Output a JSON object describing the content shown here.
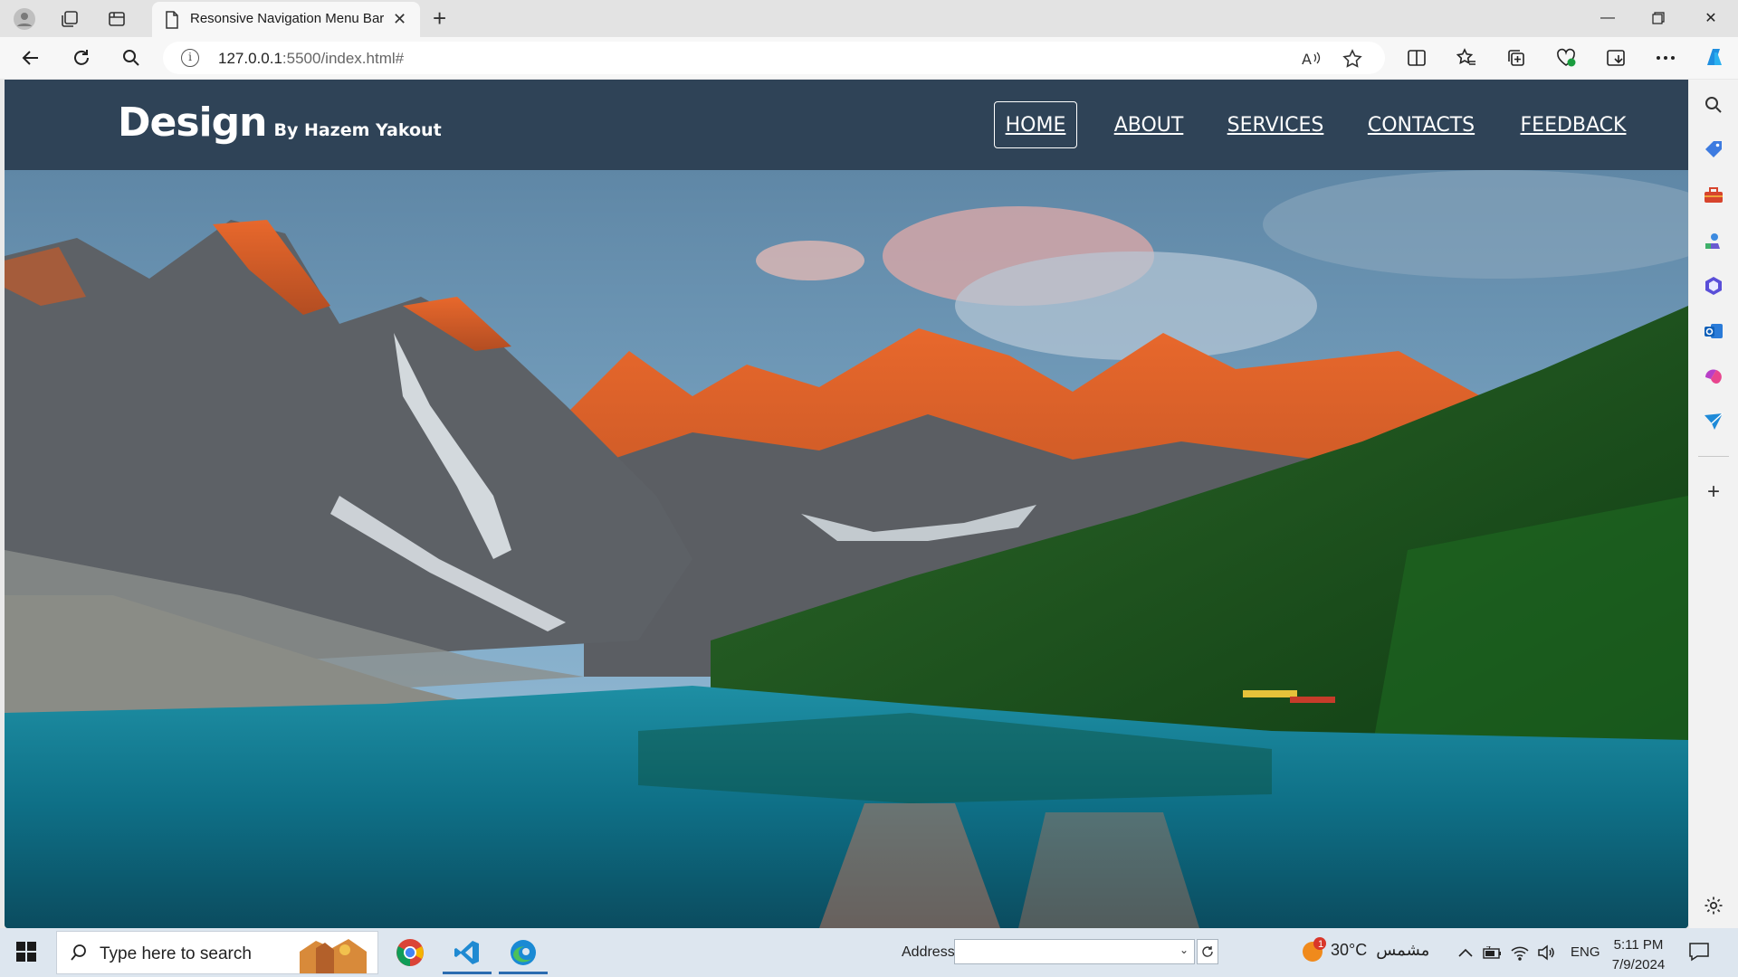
{
  "browser": {
    "tab_title": "Resonsive Navigation Menu Bar",
    "url_host": "127.0.0.1",
    "url_rest": ":5500/index.html#"
  },
  "page": {
    "logo": "Design",
    "logo_sub": "By Hazem Yakout",
    "menu": [
      {
        "label": "HOME",
        "active": true
      },
      {
        "label": "ABOUT",
        "active": false
      },
      {
        "label": "SERVICES",
        "active": false
      },
      {
        "label": "CONTACTS",
        "active": false
      },
      {
        "label": "FEEDBACK",
        "active": false
      }
    ],
    "header_color": "#2f4357"
  },
  "taskbar": {
    "search_placeholder": "Type here to search",
    "address_label": "Address",
    "weather_temp": "30°C",
    "weather_desc": "مشمس",
    "weather_badge": "1",
    "language": "ENG",
    "time": "5:11 PM",
    "date": "7/9/2024"
  }
}
